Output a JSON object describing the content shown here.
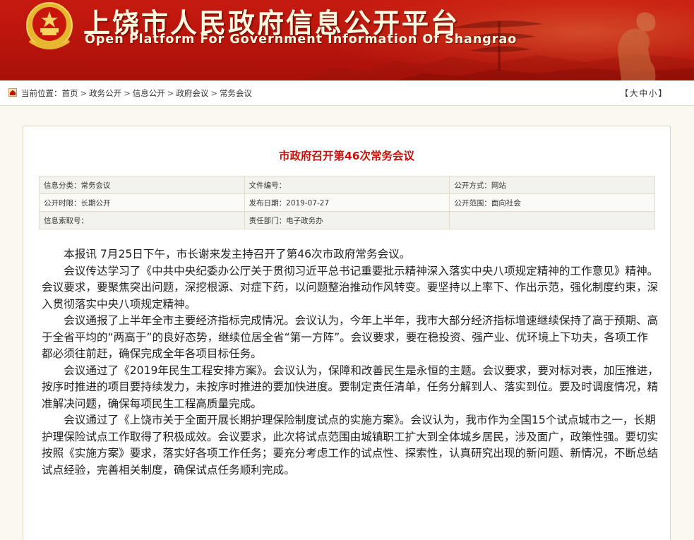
{
  "header": {
    "title_cn": "上饶市人民政府信息公开平台",
    "title_en": "Open Platform For Government Information Of Shangrao"
  },
  "breadcrumb": {
    "prefix": "当前位置：",
    "items": [
      "首页",
      "政务公开",
      "信息公开",
      "政府会议",
      "常务会议"
    ]
  },
  "font_size": {
    "open": "【",
    "large": "大",
    "medium": "中",
    "small": "小",
    "close": "】"
  },
  "article": {
    "title": "市政府召开第46次常务会议",
    "meta": [
      [
        "信息分类：常务会议",
        "文件编号：",
        "公开方式：网站"
      ],
      [
        "公开时限：长期公开",
        "发布日期：2019-07-27",
        "公开范围：面向社会"
      ],
      [
        "信息索取号：",
        "责任部门：电子政务办",
        ""
      ]
    ],
    "paragraphs": [
      "本报讯 7月25日下午，市长谢来发主持召开了第46次市政府常务会议。",
      "会议传达学习了《中共中央纪委办公厅关于贯彻习近平总书记重要批示精神深入落实中央八项规定精神的工作意见》精神。会议要求，要聚焦突出问题，深挖根源、对症下药，以问题整治推动作风转变。要坚持以上率下、作出示范，强化制度约束，深入贯彻落实中央八项规定精神。",
      "会议通报了上半年全市主要经济指标完成情况。会议认为，今年上半年，我市大部分经济指标增速继续保持了高于预期、高于全省平均的“两高于”的良好态势，继续位居全省“第一方阵”。会议要求，要在稳投资、强产业、优环境上下功夫，各项工作都必须往前赶，确保完成全年各项目标任务。",
      "会议通过了《2019年民生工程安排方案》。会议认为，保障和改善民生是永恒的主题。会议要求，要对标对表，加压推进，按序时推进的项目要持续发力，未按序时推进的要加快进度。要制定责任清单，任务分解到人、落实到位。要及时调度情况，精准解决问题，确保每项民生工程高质量完成。",
      "会议通过了《上饶市关于全面开展长期护理保险制度试点的实施方案》。会议认为，我市作为全国15个试点城市之一，长期护理保险试点工作取得了积极成效。会议要求，此次将试点范围由城镇职工扩大到全体城乡居民，涉及面广，政策性强。要切实按照《实施方案》要求，落实好各项工作任务；要充分考虑工作的试点性、探索性，认真研究出现的新问题、新情况，不断总结试点经验，完善相关制度，确保试点任务顺利完成。"
    ]
  },
  "colors": {
    "banner": "#b8140c",
    "title_red": "#c0140c",
    "page_bg": "#fbf8f1"
  }
}
